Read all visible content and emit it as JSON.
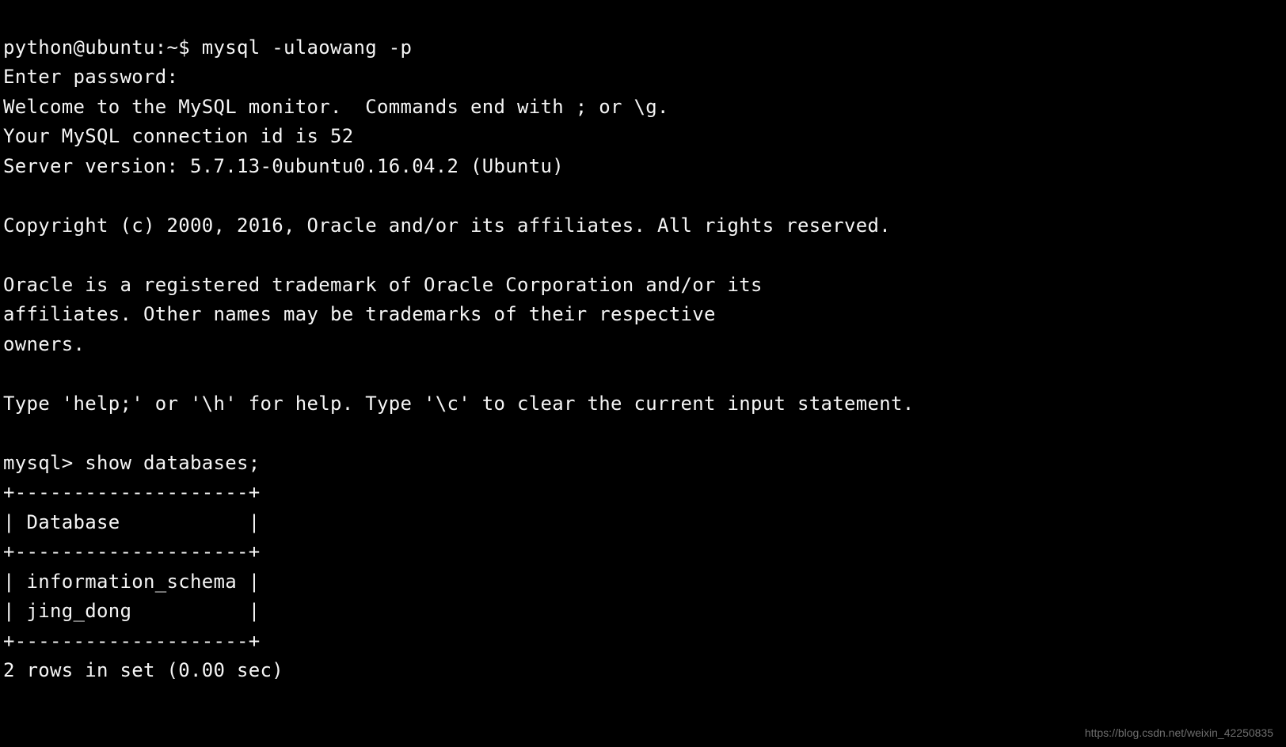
{
  "terminal": {
    "shell_prompt": "python@ubuntu:~$",
    "shell_command": "mysql -ulaowang -p",
    "lines": {
      "enter_password": "Enter password:",
      "welcome": "Welcome to the MySQL monitor.  Commands end with ; or \\g.",
      "conn_id": "Your MySQL connection id is 52",
      "server_version": "Server version: 5.7.13-0ubuntu0.16.04.2 (Ubuntu)",
      "copyright": "Copyright (c) 2000, 2016, Oracle and/or its affiliates. All rights reserved.",
      "trademark1": "Oracle is a registered trademark of Oracle Corporation and/or its",
      "trademark2": "affiliates. Other names may be trademarks of their respective",
      "trademark3": "owners.",
      "help_line": "Type 'help;' or '\\h' for help. Type '\\c' to clear the current input statement."
    },
    "mysql_prompt": "mysql>",
    "mysql_command": "show databases;",
    "table": {
      "border": "+--------------------+",
      "header": "| Database           |",
      "rows": [
        "| information_schema |",
        "| jing_dong          |"
      ],
      "footer": "2 rows in set (0.00 sec)"
    }
  },
  "watermark": "https://blog.csdn.net/weixin_42250835"
}
